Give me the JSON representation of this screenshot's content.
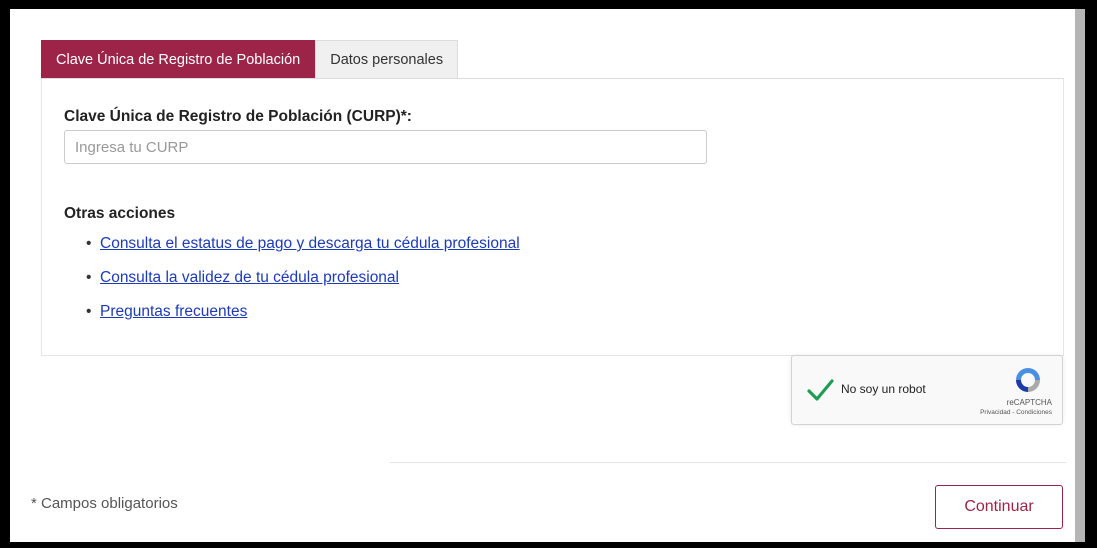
{
  "tabs": [
    {
      "label": "Clave Única de Registro de Población",
      "active": true
    },
    {
      "label": "Datos personales",
      "active": false
    }
  ],
  "curp": {
    "label": "Clave Única de Registro de Población (CURP)*:",
    "placeholder": "Ingresa tu CURP",
    "value": ""
  },
  "other_actions": {
    "title": "Otras acciones",
    "links": [
      "Consulta el estatus de pago y descarga tu cédula profesional",
      "Consulta la validez de tu cédula profesional",
      "Preguntas frecuentes"
    ]
  },
  "captcha": {
    "label": "No soy un robot",
    "brand": "reCAPTCHA",
    "terms": "Privacidad - Condiciones",
    "checked": true
  },
  "footer": {
    "required_note": "* Campos obligatorios",
    "continue_label": "Continuar"
  },
  "colors": {
    "accent": "#9d2449",
    "link": "#1d3ab8",
    "check": "#1f9d55"
  }
}
